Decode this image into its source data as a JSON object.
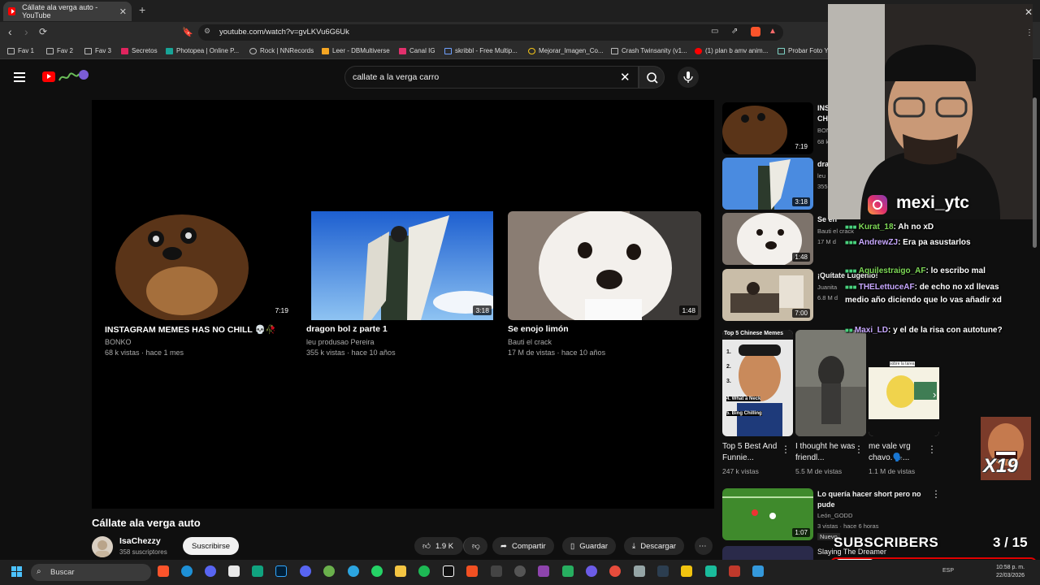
{
  "browser": {
    "tab_title": "Cállate ala verga auto - YouTube",
    "url": "youtube.com/watch?v=gvLKVu6G6Uk",
    "bookmarks": [
      "Fav 1",
      "Fav 2",
      "Fav 3",
      "Secretos",
      "Photopea | Online P...",
      "Rock | NNRecords",
      "Leer - DBMultiverse",
      "Canal IG",
      "skribbl - Free Multip...",
      "Mejorar_Imagen_Co...",
      "Crash Twinsanity (v1...",
      "(1) plan b amv anim...",
      "Probar Foto Y"
    ]
  },
  "header": {
    "search_query": "callate a la verga carro"
  },
  "endscreen": [
    {
      "title": "INSTAGRAM MEMES HAS NO CHILL 💀🥀",
      "channel": "BONKO",
      "meta": "68 k vistas · hace 1 mes",
      "duration": "7:19"
    },
    {
      "title": "dragon bol z parte 1",
      "channel": "leu produsao Pereira",
      "meta": "355 k vistas · hace 10 años",
      "duration": "3:18"
    },
    {
      "title": "Se enojo limón",
      "channel": "Bauti el crack",
      "meta": "17 M de vistas · hace 10 años",
      "duration": "1:48"
    }
  ],
  "video": {
    "title": "Cállate ala verga auto",
    "channel": "IsaChezzy",
    "subscribers": "358 suscriptores",
    "subscribe_label": "Suscribirse",
    "likes": "1.9 K",
    "share_label": "Compartir",
    "save_label": "Guardar",
    "download_label": "Descargar"
  },
  "sidebar": {
    "videos": [
      {
        "title": "INS",
        "title2": "CH",
        "channel": "BON",
        "meta": "68 k",
        "duration": "7:19"
      },
      {
        "title": "dra",
        "channel": "leu",
        "meta": "355",
        "duration": "3:18"
      },
      {
        "title": "Se en",
        "channel": "Bauti el crack",
        "meta": "17 M d",
        "duration": "1:48"
      },
      {
        "title": "¡Quítate Lugenio!",
        "channel": "Juanita",
        "meta": "6.8 M d",
        "duration": "7:00"
      }
    ],
    "shorts": [
      {
        "title": "Top 5 Best And Funnie...",
        "views": "247 k vistas",
        "overlay": "Top 5 Chinese Memes",
        "items": [
          "1.",
          "2.",
          "3.",
          "4. What a Neck",
          "5. Bing Chilling"
        ]
      },
      {
        "title": "I thought he was friendl...",
        "views": "5.5 M de vistas"
      },
      {
        "title": "me vale vrg chavo.🗣️...",
        "views": "1.1 M de vistas",
        "overlay": "sobre la tarea"
      }
    ],
    "bottom_video": {
      "title": "Lo quería hacer short pero no pude",
      "channel": "León_GODD",
      "meta": "3 vistas · hace 6 horas",
      "duration": "1:07",
      "badge": "Nuevo"
    },
    "next_video_title": "Slaying The Dreamer"
  },
  "stream_overlay": {
    "instagram": "mexi_ytc",
    "chat": [
      {
        "user": "Kurat_18",
        "msg": ": Ah no xD"
      },
      {
        "user": "AndrewZJ",
        "msg": ": Era pa asustarlos"
      },
      {
        "user": "Aquilestraigo_AF",
        "msg": ": lo escribo mal"
      },
      {
        "user": "THELettuceAF",
        "msg": ": de echo no xd llevas medio año diciendo que lo vas añadir xd"
      },
      {
        "user": "Maxi_LD",
        "msg": ": y el de la risa con autotune?"
      }
    ],
    "sub_goal_label": "SUBSCRIBERS",
    "sub_goal_count": "3  / 15",
    "sub_goal_progress": 0.2,
    "multiplier": "X19"
  },
  "taskbar": {
    "search_placeholder": "Buscar",
    "lang": "ESP",
    "time": "10:58 p. m.",
    "date": "22/03/2026"
  },
  "colors": {
    "brand": "#ff0000",
    "background": "#0f0f0f",
    "goal_border": "#e00000"
  }
}
